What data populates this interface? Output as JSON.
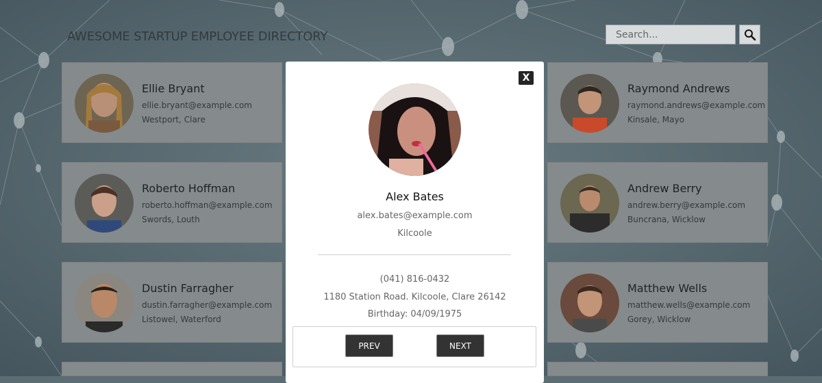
{
  "header": {
    "title": "AWESOME STARTUP EMPLOYEE DIRECTORY"
  },
  "search": {
    "placeholder": "Search..."
  },
  "cards": [
    {
      "name": "Ellie Bryant",
      "email": "ellie.bryant@example.com",
      "location": "Westport, Clare"
    },
    {
      "name": "Raymond Andrews",
      "email": "raymond.andrews@example.com",
      "location": "Kinsale, Mayo"
    },
    {
      "name": "Roberto Hoffman",
      "email": "roberto.hoffman@example.com",
      "location": "Swords, Louth"
    },
    {
      "name": "Andrew Berry",
      "email": "andrew.berry@example.com",
      "location": "Buncrana, Wicklow"
    },
    {
      "name": "Dustin Farragher",
      "email": "dustin.farragher@example.com",
      "location": "Listowel, Waterford"
    },
    {
      "name": "Matthew Wells",
      "email": "matthew.wells@example.com",
      "location": "Gorey, Wicklow"
    }
  ],
  "modal": {
    "close_label": "X",
    "name": "Alex Bates",
    "email": "alex.bates@example.com",
    "city": "Kilcoole",
    "phone": "(041) 816-0432",
    "address": "1180 Station Road. Kilcoole, Clare 26142",
    "birthday": "Birthday: 04/09/1975",
    "prev_label": "PREV",
    "next_label": "NEXT"
  },
  "colors": {
    "background": "#5c6c73",
    "card": "#858a8c",
    "modal": "#ffffff",
    "button": "#333333"
  }
}
